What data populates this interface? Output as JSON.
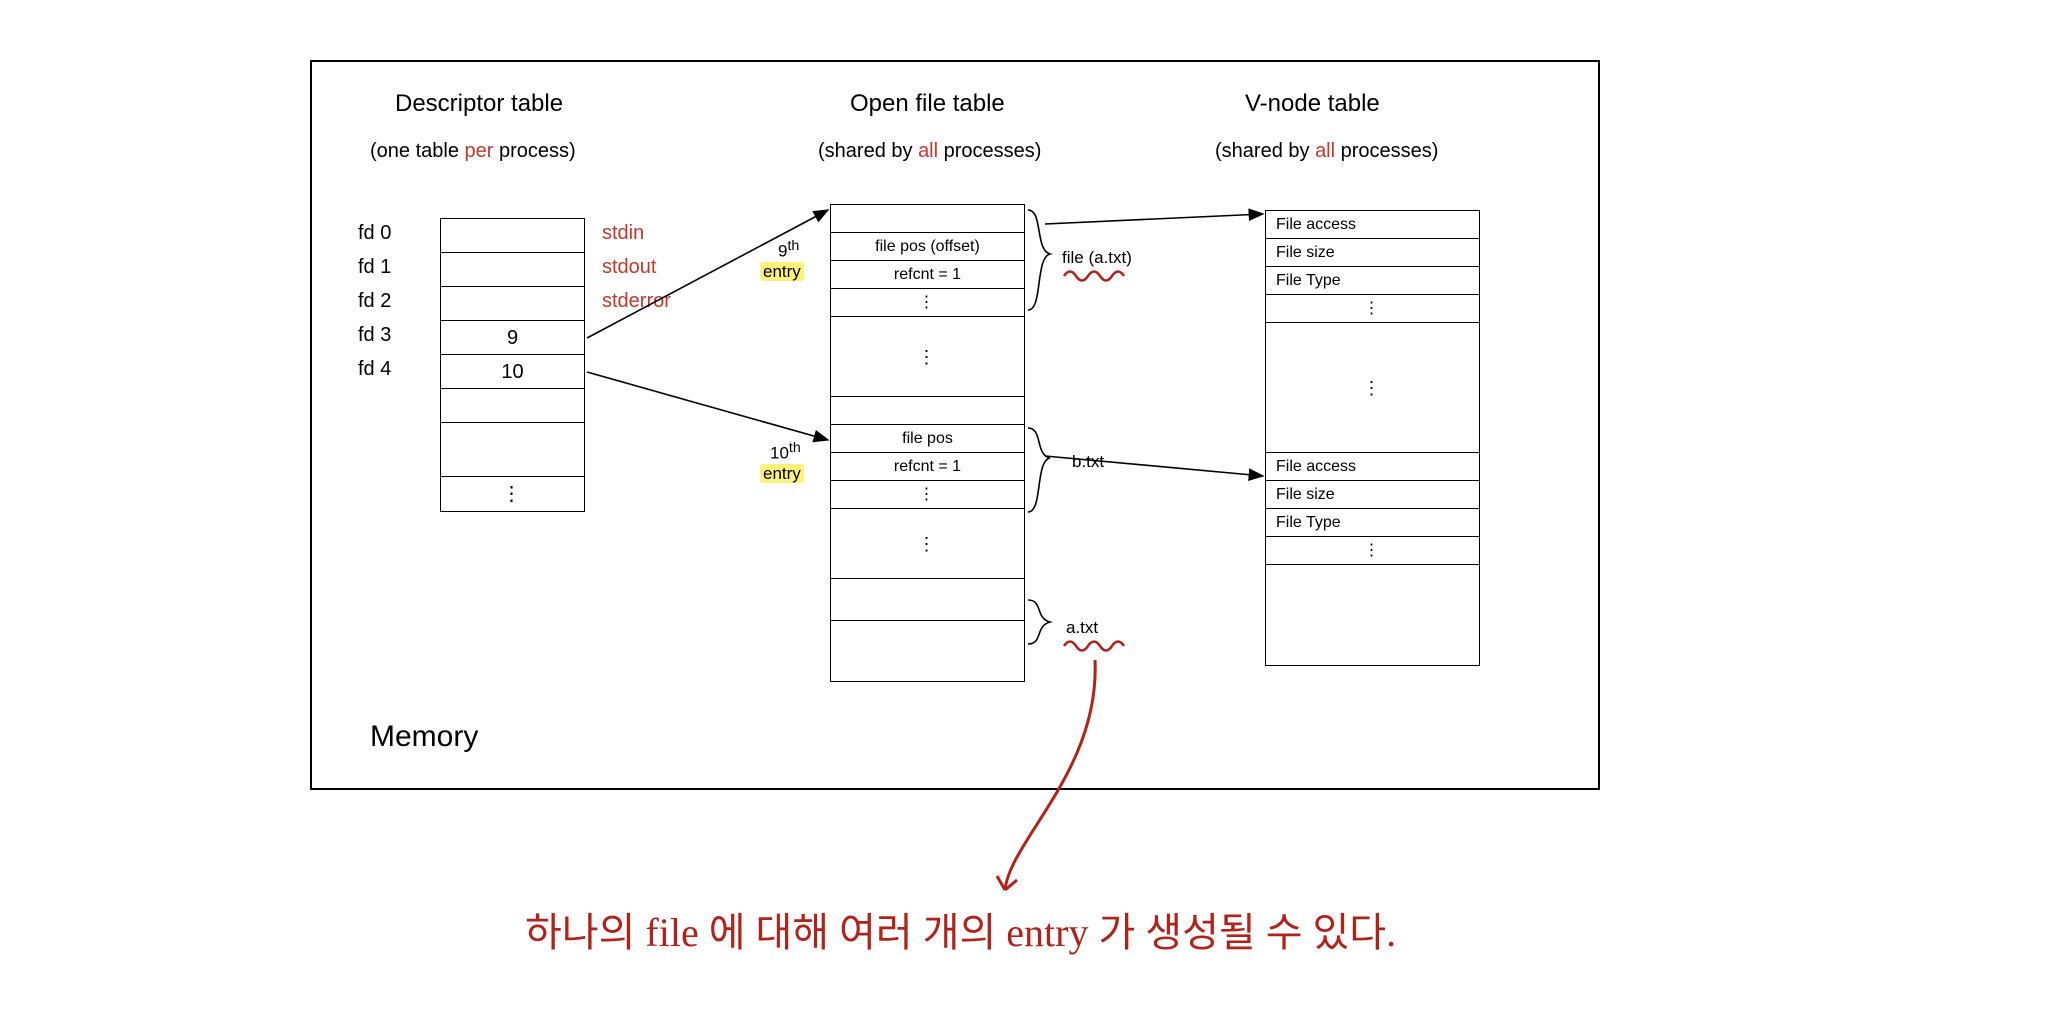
{
  "memory_label": "Memory",
  "descriptor": {
    "title": "Descriptor table",
    "subtitle_pre": "(one table ",
    "subtitle_em": "per",
    "subtitle_post": " process)",
    "fd_labels": [
      "fd 0",
      "fd 1",
      "fd 2",
      "fd 3",
      "fd 4"
    ],
    "std_labels": [
      "stdin",
      "stdout",
      "stderror"
    ],
    "values": {
      "fd3": "9",
      "fd4": "10"
    },
    "dots": "⋮"
  },
  "openfile": {
    "title": "Open file table",
    "subtitle_pre": "(shared by ",
    "subtitle_em": "all",
    "subtitle_post": " processes)",
    "entry9_sup": "9",
    "entry9_ord": "th",
    "entry9_word": "entry",
    "entry10_sup": "10",
    "entry10_ord": "th",
    "entry10_word": "entry",
    "rows": {
      "filepos1": "file pos (offset)",
      "refcnt1": "refcnt = 1",
      "filepos2": "file pos",
      "refcnt2": "refcnt = 1"
    },
    "file_a": "file (a.txt)",
    "file_b": "b.txt",
    "file_a2": "a.txt",
    "dots": "⋮"
  },
  "vnode": {
    "title": "V-node table",
    "subtitle_pre": "(shared by ",
    "subtitle_em": "all",
    "subtitle_post": " processes)",
    "rows": {
      "access": "File access",
      "size": "File size",
      "type": "File Type"
    },
    "dots": "⋮"
  },
  "caption": "하나의 file 에 대해  여러 개의  entry 가  생성될 수 있다."
}
